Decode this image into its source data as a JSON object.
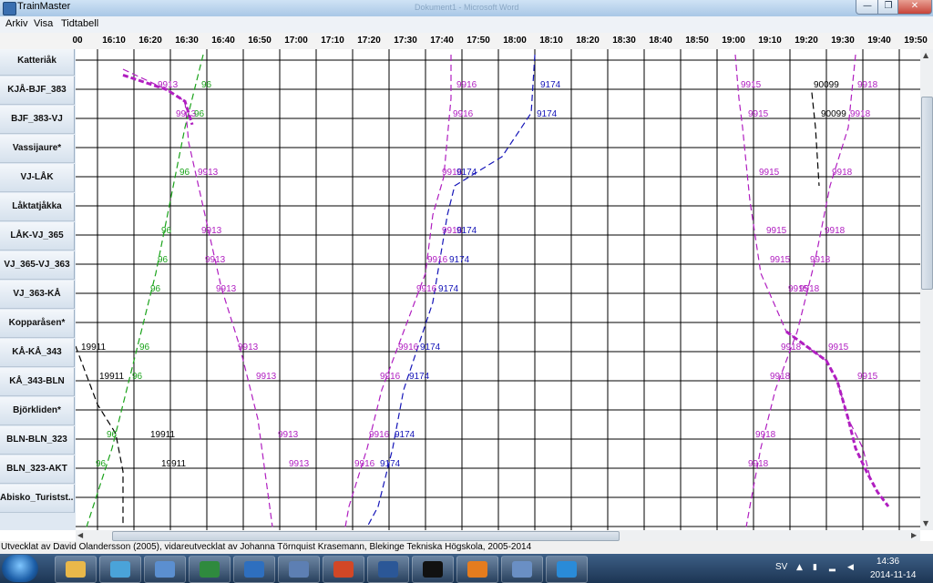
{
  "window": {
    "app_title": "TrainMaster",
    "doc_title": "Dokument1 - Microsoft Word",
    "min_label": "—",
    "max_label": "❐",
    "close_label": "✕"
  },
  "menu": [
    "Arkiv",
    "Visa",
    "Tidtabell"
  ],
  "time_axis": {
    "start_min": 960,
    "end_min": 1195,
    "ticks": [
      "00",
      "16:10",
      "16:20",
      "16:30",
      "16:40",
      "16:50",
      "17:00",
      "17:10",
      "17:20",
      "17:30",
      "17:40",
      "17:50",
      "18:00",
      "18:10",
      "18:20",
      "18:30",
      "18:40",
      "18:50",
      "19:00",
      "19:10",
      "19:20",
      "19:30",
      "19:40",
      "19:50"
    ]
  },
  "stations": [
    "Katteriåk",
    "KJÅ-BJF_383",
    "BJF_383-VJ",
    "Vassijaure*",
    "VJ-LÅK",
    "Låktatjåkka",
    "LÅK-VJ_365",
    "VJ_365-VJ_363",
    "VJ_363-KÅ",
    "Kopparåsen*",
    "KÅ-KÅ_343",
    "KÅ_343-BLN",
    "Björkliden*",
    "BLN-BLN_323",
    "BLN_323-AKT",
    "Abisko_Turistst..."
  ],
  "trains": [
    {
      "id": "9913",
      "color": "#b01ec0",
      "path": [
        [
          973,
          0.5
        ],
        [
          985,
          1.2
        ],
        [
          990,
          1.6
        ],
        [
          991,
          3.0
        ],
        [
          1000,
          8.0
        ],
        [
          1005,
          10.0
        ],
        [
          1010,
          12.5
        ],
        [
          1014,
          16.2
        ]
      ],
      "labels": [
        {
          "text": "9913",
          "t": 982,
          "r": 1
        },
        {
          "text": "9913",
          "t": 987,
          "r": 2
        },
        {
          "text": "9913",
          "t": 993,
          "r": 4
        },
        {
          "text": "9913",
          "t": 994,
          "r": 6
        },
        {
          "text": "9913",
          "t": 995,
          "r": 7
        },
        {
          "text": "9913",
          "t": 998,
          "r": 8
        },
        {
          "text": "9913",
          "t": 1004,
          "r": 10
        },
        {
          "text": "9913",
          "t": 1009,
          "r": 11
        },
        {
          "text": "9913",
          "t": 1015,
          "r": 13
        },
        {
          "text": "9913",
          "t": 1018,
          "r": 14
        }
      ]
    },
    {
      "id": "96",
      "color": "#1aa31a",
      "path": [
        [
          995,
          0
        ],
        [
          990,
          2.5
        ],
        [
          982,
          7.5
        ],
        [
          976,
          10.5
        ],
        [
          970,
          13.5
        ],
        [
          963,
          16.2
        ]
      ],
      "labels": [
        {
          "text": "96",
          "t": 994,
          "r": 1
        },
        {
          "text": "96",
          "t": 992,
          "r": 2
        },
        {
          "text": "96",
          "t": 988,
          "r": 4
        },
        {
          "text": "96",
          "t": 983,
          "r": 6
        },
        {
          "text": "96",
          "t": 982,
          "r": 7
        },
        {
          "text": "96",
          "t": 980,
          "r": 8
        },
        {
          "text": "96",
          "t": 977,
          "r": 10
        },
        {
          "text": "96",
          "t": 975,
          "r": 11
        },
        {
          "text": "96",
          "t": 968,
          "r": 13
        },
        {
          "text": "96",
          "t": 965,
          "r": 14
        }
      ]
    },
    {
      "id": "19911",
      "color": "#000000",
      "path": [
        [
          960,
          10
        ],
        [
          966,
          12
        ],
        [
          971,
          13
        ],
        [
          973,
          14.3
        ],
        [
          973,
          16.2
        ]
      ],
      "labels": [
        {
          "text": "19911",
          "t": 961,
          "r": 10
        },
        {
          "text": "19911",
          "t": 966,
          "r": 11
        },
        {
          "text": "19911",
          "t": 980,
          "r": 13
        },
        {
          "text": "19911",
          "t": 983,
          "r": 14
        }
      ]
    },
    {
      "id": "9916",
      "color": "#b01ec0",
      "path": [
        [
          1063,
          0
        ],
        [
          1063,
          1.5
        ],
        [
          1061,
          4.2
        ],
        [
          1058,
          5.5
        ],
        [
          1056,
          7.5
        ],
        [
          1050,
          9.5
        ],
        [
          1044,
          11.5
        ],
        [
          1040,
          13.5
        ],
        [
          1035,
          15.5
        ],
        [
          1034,
          16.2
        ]
      ],
      "labels": [
        {
          "text": "9916",
          "t": 1064,
          "r": 1
        },
        {
          "text": "9916",
          "t": 1063,
          "r": 2
        },
        {
          "text": "9916",
          "t": 1060,
          "r": 4
        },
        {
          "text": "9916",
          "t": 1060,
          "r": 6
        },
        {
          "text": "9916",
          "t": 1056,
          "r": 7
        },
        {
          "text": "9916",
          "t": 1053,
          "r": 8
        },
        {
          "text": "9916",
          "t": 1048,
          "r": 10
        },
        {
          "text": "9916",
          "t": 1043,
          "r": 11
        },
        {
          "text": "9916",
          "t": 1040,
          "r": 13
        },
        {
          "text": "9916",
          "t": 1036,
          "r": 14
        }
      ]
    },
    {
      "id": "9174",
      "color": "#1515b8",
      "path": [
        [
          1086,
          0
        ],
        [
          1085,
          2.0
        ],
        [
          1077,
          3.5
        ],
        [
          1064,
          4.5
        ],
        [
          1062,
          5.5
        ],
        [
          1060,
          7.0
        ],
        [
          1058,
          8.5
        ],
        [
          1054,
          10.0
        ],
        [
          1050,
          11.5
        ],
        [
          1047,
          13.5
        ],
        [
          1043,
          15.5
        ],
        [
          1040,
          16.2
        ]
      ],
      "labels": [
        {
          "text": "9174",
          "t": 1087,
          "r": 1
        },
        {
          "text": "9174",
          "t": 1086,
          "r": 2
        },
        {
          "text": "9174",
          "t": 1064,
          "r": 4
        },
        {
          "text": "9174",
          "t": 1064,
          "r": 6
        },
        {
          "text": "9174",
          "t": 1062,
          "r": 7
        },
        {
          "text": "9174",
          "t": 1059,
          "r": 8
        },
        {
          "text": "9174",
          "t": 1054,
          "r": 10
        },
        {
          "text": "9174",
          "t": 1051,
          "r": 11
        },
        {
          "text": "9174",
          "t": 1047,
          "r": 13
        },
        {
          "text": "9174",
          "t": 1043,
          "r": 14
        }
      ]
    },
    {
      "id": "9915",
      "color": "#b01ec0",
      "path": [
        [
          1141,
          0
        ],
        [
          1142,
          1.5
        ],
        [
          1143,
          2.5
        ],
        [
          1145,
          5.0
        ],
        [
          1148,
          7.5
        ],
        [
          1155,
          9.5
        ],
        [
          1166,
          10.5
        ],
        [
          1169,
          11.2
        ],
        [
          1172,
          12.5
        ],
        [
          1176,
          13.5
        ],
        [
          1178,
          14.5
        ]
      ],
      "labels": [
        {
          "text": "9915",
          "t": 1142,
          "r": 1
        },
        {
          "text": "9915",
          "t": 1144,
          "r": 2
        },
        {
          "text": "9915",
          "t": 1147,
          "r": 4
        },
        {
          "text": "9915",
          "t": 1149,
          "r": 6
        },
        {
          "text": "9915",
          "t": 1150,
          "r": 7
        },
        {
          "text": "9915",
          "t": 1155,
          "r": 8
        },
        {
          "text": "9915",
          "t": 1166,
          "r": 10
        },
        {
          "text": "9915",
          "t": 1174,
          "r": 11
        }
      ]
    },
    {
      "id": "9918",
      "color": "#b01ec0",
      "path": [
        [
          1174,
          0
        ],
        [
          1172,
          2.5
        ],
        [
          1167,
          4.5
        ],
        [
          1163,
          7.0
        ],
        [
          1158,
          9.5
        ],
        [
          1152,
          11.5
        ],
        [
          1148,
          13.5
        ],
        [
          1145,
          15.5
        ],
        [
          1144,
          16.2
        ]
      ],
      "labels": [
        {
          "text": "9918",
          "t": 1174,
          "r": 1
        },
        {
          "text": "9918",
          "t": 1172,
          "r": 2
        },
        {
          "text": "9918",
          "t": 1167,
          "r": 4
        },
        {
          "text": "9918",
          "t": 1165,
          "r": 6
        },
        {
          "text": "9918",
          "t": 1161,
          "r": 7
        },
        {
          "text": "9918",
          "t": 1158,
          "r": 8
        },
        {
          "text": "9918",
          "t": 1153,
          "r": 10
        },
        {
          "text": "9918",
          "t": 1150,
          "r": 11
        },
        {
          "text": "9918",
          "t": 1146,
          "r": 13
        },
        {
          "text": "9918",
          "t": 1144,
          "r": 14
        }
      ]
    },
    {
      "id": "90099",
      "color": "#000000",
      "path": [
        [
          1162,
          1.3
        ],
        [
          1163,
          2.5
        ],
        [
          1164,
          4.5
        ]
      ],
      "labels": [
        {
          "text": "90099",
          "t": 1162,
          "r": 1
        },
        {
          "text": "90099",
          "t": 1164,
          "r": 2
        }
      ]
    }
  ],
  "meets": [
    {
      "color": "#b01ec0",
      "path": [
        [
          973,
          0.7
        ],
        [
          985,
          1.2
        ],
        [
          990,
          1.6
        ],
        [
          992,
          2.4
        ]
      ]
    },
    {
      "color": "#b01ec0",
      "path": [
        [
          1155,
          9.5
        ],
        [
          1166,
          10.5
        ],
        [
          1169,
          11.2
        ],
        [
          1172,
          12.5
        ],
        [
          1174,
          13.5
        ],
        [
          1177,
          14.3
        ],
        [
          1180,
          15.0
        ],
        [
          1183,
          15.5
        ]
      ]
    }
  ],
  "status": "Utvecklat av David Olandersson (2005), vidareutvecklat av Johanna Törnquist Krasemann, Blekinge Tekniska Högskola, 2005-2014",
  "taskbar": {
    "apps": [
      {
        "name": "file-explorer",
        "color": "#e9b84a"
      },
      {
        "name": "network-app",
        "color": "#4aa3d9"
      },
      {
        "name": "trainmaster-app",
        "color": "#5b8fd0"
      },
      {
        "name": "excel",
        "color": "#2f8a3e"
      },
      {
        "name": "notes-app",
        "color": "#2e6fbf"
      },
      {
        "name": "remote-desktop",
        "color": "#5d7fb3"
      },
      {
        "name": "powerpoint",
        "color": "#d24726"
      },
      {
        "name": "word",
        "color": "#2b5797"
      },
      {
        "name": "command-prompt",
        "color": "#111111"
      },
      {
        "name": "java",
        "color": "#e57c1e"
      },
      {
        "name": "image-viewer",
        "color": "#6a8fc4"
      },
      {
        "name": "internet-explorer",
        "color": "#2a8bd8"
      }
    ],
    "lang": "SV",
    "time": "14:36",
    "date": "2014-11-14"
  }
}
